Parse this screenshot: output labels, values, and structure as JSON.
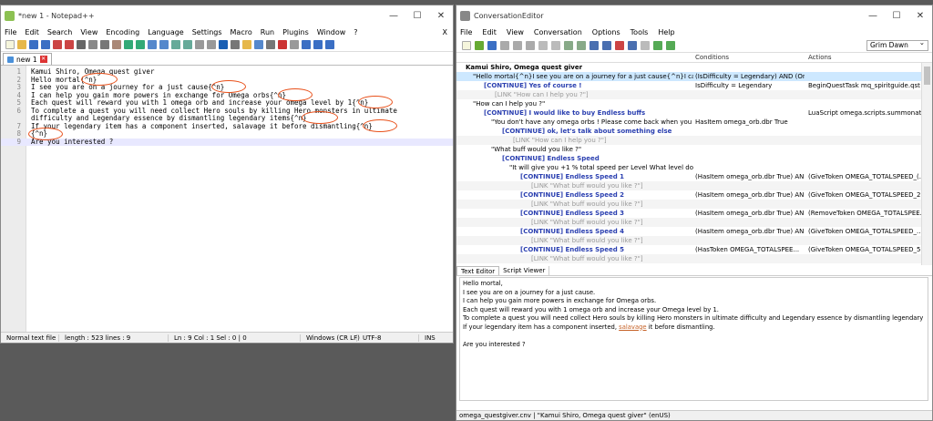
{
  "notepad": {
    "title": "*new 1 - Notepad++",
    "menu": [
      "File",
      "Edit",
      "Search",
      "View",
      "Encoding",
      "Language",
      "Settings",
      "Macro",
      "Run",
      "Plugins",
      "Window",
      "?"
    ],
    "close_x": "X",
    "tab_label": "new 1",
    "lines": [
      {
        "n": "1",
        "text": "Kamui Shiro, Omega quest giver"
      },
      {
        "n": "2",
        "text": "Hello mortal{^n}"
      },
      {
        "n": "3",
        "text": "I see you are on a journey for a just cause{^n}"
      },
      {
        "n": "4",
        "text": "I can help you gain more powers in exchange for Omega orbs{^n}"
      },
      {
        "n": "5",
        "text": "Each quest will reward you with 1 omega orb and increase your omega level by 1{^n}"
      },
      {
        "n": "6",
        "text": "To complete a quest you will need collect Hero souls by killing Hero monsters in ultimate"
      },
      {
        "n": "",
        "text": "difficulty and Legendary essence by dismantling legendary items{^n}"
      },
      {
        "n": "7",
        "text": "If your legendary item has a component inserted, salavage it before dismantling{^n}"
      },
      {
        "n": "8",
        "text": "{^n}"
      },
      {
        "n": "9",
        "text": "Are you interested ?"
      }
    ],
    "status": {
      "type": "Normal text file",
      "length": "length : 523    lines : 9",
      "pos": "Ln : 9    Col : 1    Sel : 0 | 0",
      "eol": "Windows (CR LF)",
      "enc": "UTF-8",
      "mode": "INS"
    }
  },
  "ce": {
    "title": "ConversationEditor",
    "menu": [
      "File",
      "Edit",
      "View",
      "Conversation",
      "Options",
      "Tools",
      "Help"
    ],
    "combo": "Grim Dawn",
    "col_conditions": "Conditions",
    "col_actions": "Actions",
    "nodes": [
      {
        "c1": "Kamui Shiro, Omega quest giver",
        "c2": "",
        "c3": ""
      },
      {
        "c1": "\"Hello mortal{^n}I see you are on a journey for a just cause{^n}I can help you...",
        "c2": "(IsDifficulty = Legendary) AND (OnQu...",
        "c3": ""
      },
      {
        "c1": "[CONTINUE] Yes of course !",
        "c2": "IsDifficulty = Legendary",
        "c3": "BeginQuestTask mq_spiritguide.qst ?"
      },
      {
        "c1": "[LINK \"How can I help you ?\"]",
        "c2": "",
        "c3": ""
      },
      {
        "c1": "\"How can I help you ?\"",
        "c2": "",
        "c3": ""
      },
      {
        "c1": "[CONTINUE] I would like to buy Endless buffs",
        "c2": "",
        "c3": "LuaScript omega.scripts.summonatf..."
      },
      {
        "c1": "\"You don't have any omega orbs ! Please come back when you have ...",
        "c2": "HasItem omega_orb.dbr True",
        "c3": ""
      },
      {
        "c1": "[CONTINUE] ok, let's talk about something else",
        "c2": "",
        "c3": ""
      },
      {
        "c1": "[LINK \"How can I help you ?\"]",
        "c2": "",
        "c3": ""
      },
      {
        "c1": "\"What buff would you like ?\"",
        "c2": "",
        "c3": ""
      },
      {
        "c1": "[CONTINUE] Endless Speed",
        "c2": "",
        "c3": ""
      },
      {
        "c1": "\"It will give you +1 % total speed per Level What level do you ...",
        "c2": "",
        "c3": ""
      },
      {
        "c1": "[CONTINUE] Endless Speed 1",
        "c2": "(HasItem omega_orb.dbr True) AND (...",
        "c3": "(GiveToken OMEGA_TOTALSPEED_(..."
      },
      {
        "c1": "[LINK \"What buff would you like ?\"]",
        "c2": "",
        "c3": ""
      },
      {
        "c1": "[CONTINUE] Endless Speed 2",
        "c2": "(HasItem omega_orb.dbr True) AND (...",
        "c3": "(GiveToken OMEGA_TOTALSPEED_2)..."
      },
      {
        "c1": "[LINK \"What buff would you like ?\"]",
        "c2": "",
        "c3": ""
      },
      {
        "c1": "[CONTINUE] Endless Speed 3",
        "c2": "(HasItem omega_orb.dbr True) AND (...",
        "c3": "(RemoveToken OMEGA_TOTALSPEE..."
      },
      {
        "c1": "[LINK \"What buff would you like ?\"]",
        "c2": "",
        "c3": ""
      },
      {
        "c1": "[CONTINUE] Endless Speed 4",
        "c2": "(HasItem omega_orb.dbr True) AND (...",
        "c3": "(GiveToken OMEGA_TOTALSPEED_..."
      },
      {
        "c1": "[LINK \"What buff would you like ?\"]",
        "c2": "",
        "c3": ""
      },
      {
        "c1": "[CONTINUE] Endless Speed 5",
        "c2": "(HasToken OMEGA_TOTALSPEE...",
        "c3": "(GiveToken OMEGA_TOTALSPEED_5)..."
      },
      {
        "c1": "[LINK \"What buff would you like ?\"]",
        "c2": "",
        "c3": ""
      }
    ],
    "tabs": [
      "Text Editor",
      "Script Viewer"
    ],
    "text_lines": [
      "Hello mortal,",
      "I see you are on a journey for a just cause.",
      "I can help you gain more powers in exchange for Omega orbs.",
      "Each quest will reward you with 1 omega orb and increase your Omega level by 1.",
      "To complete a quest you will need collect Hero souls by killing Hero monsters in ultimate difficulty and Legendary essence by dismantling legendary items.",
      "If your legendary item has a component inserted,",
      "salavage",
      "it before dismantling.",
      "",
      "Are you interested ?"
    ],
    "status": "omega_questgiver.cnv | \"Kamui Shiro, Omega quest giver\" (enUS)"
  },
  "colors": {
    "accent": "#e8501a",
    "keyword": "#2a3fb0",
    "selection": "#cde8ff"
  }
}
